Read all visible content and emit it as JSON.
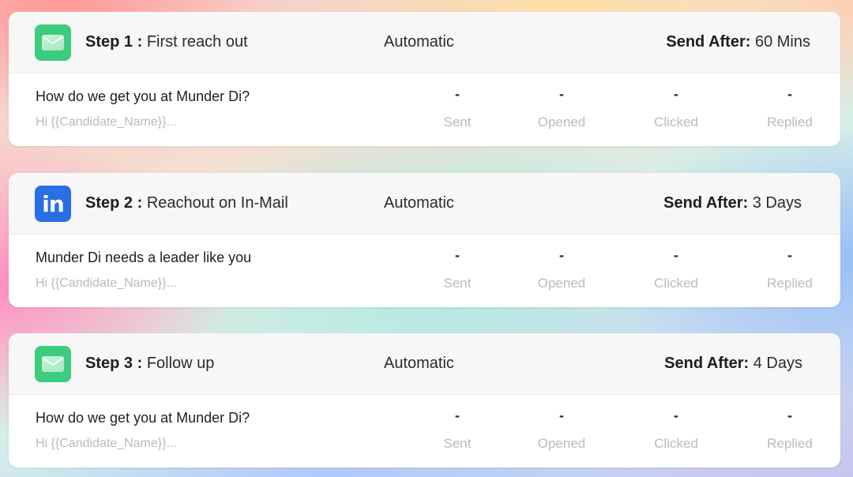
{
  "steps": [
    {
      "icon": "mail-icon",
      "step_label": "Step 1 :",
      "title": "First reach out",
      "mode": "Automatic",
      "send_after_label": "Send After:",
      "send_after_value": "60 Mins",
      "subject": "How do we get you at Munder Di?",
      "preview": "Hi {{Candidate_Name}}...",
      "stats": {
        "sent": {
          "value": "-",
          "label": "Sent"
        },
        "opened": {
          "value": "-",
          "label": "Opened"
        },
        "clicked": {
          "value": "-",
          "label": "Clicked"
        },
        "replied": {
          "value": "-",
          "label": "Replied"
        }
      }
    },
    {
      "icon": "linkedin-icon",
      "icon_text": "in",
      "step_label": "Step 2 :",
      "title": "Reachout on In-Mail",
      "mode": "Automatic",
      "send_after_label": "Send After:",
      "send_after_value": "3 Days",
      "subject": "Munder Di needs a leader like you",
      "preview": "Hi {{Candidate_Name}}...",
      "stats": {
        "sent": {
          "value": "-",
          "label": "Sent"
        },
        "opened": {
          "value": "-",
          "label": "Opened"
        },
        "clicked": {
          "value": "-",
          "label": "Clicked"
        },
        "replied": {
          "value": "-",
          "label": "Replied"
        }
      }
    },
    {
      "icon": "mail-icon",
      "step_label": "Step 3 :",
      "title": "Follow up",
      "mode": "Automatic",
      "send_after_label": "Send After:",
      "send_after_value": "4 Days",
      "subject": "How do we get you at Munder Di?",
      "preview": "Hi {{Candidate_Name}}...",
      "stats": {
        "sent": {
          "value": "-",
          "label": "Sent"
        },
        "opened": {
          "value": "-",
          "label": "Opened"
        },
        "clicked": {
          "value": "-",
          "label": "Clicked"
        },
        "replied": {
          "value": "-",
          "label": "Replied"
        }
      }
    }
  ],
  "colors": {
    "email_icon_bg": "#3dcb7e",
    "linkedin_icon_bg": "#2a6ee6",
    "muted_text": "#b9b9c0"
  }
}
